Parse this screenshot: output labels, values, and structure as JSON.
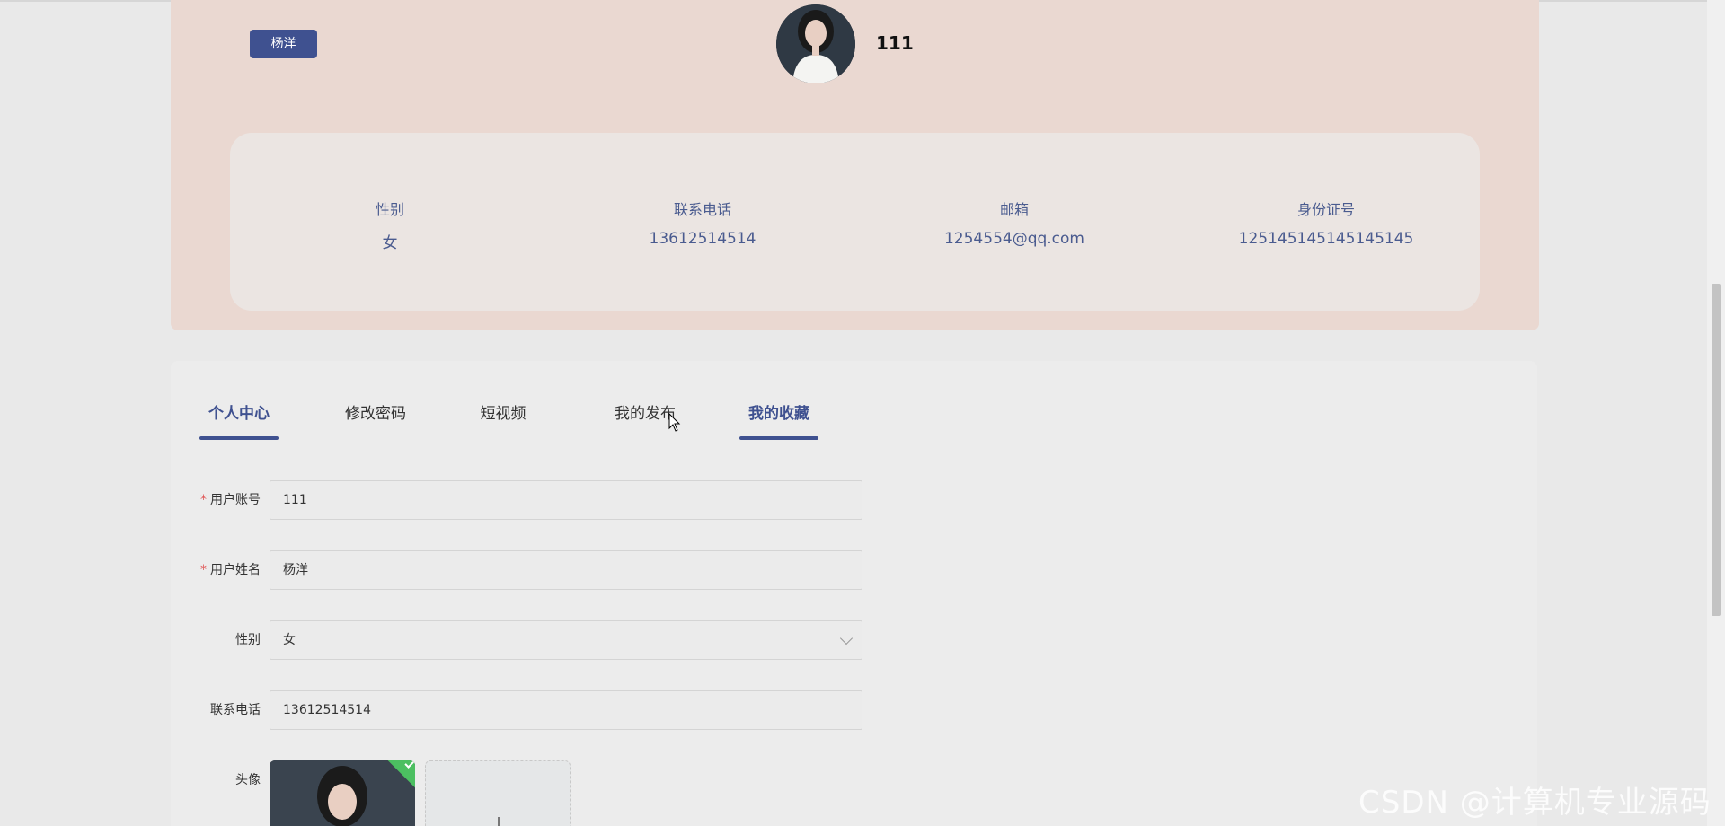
{
  "header": {
    "name_tag": "杨洋",
    "username": "111"
  },
  "info": {
    "items": [
      {
        "label": "性别",
        "value": "女"
      },
      {
        "label": "联系电话",
        "value": "13612514514"
      },
      {
        "label": "邮箱",
        "value": "1254554@qq.com"
      },
      {
        "label": "身份证号",
        "value": "125145145145145145"
      }
    ]
  },
  "tabs": [
    {
      "label": "个人中心",
      "active": true
    },
    {
      "label": "修改密码",
      "active": false
    },
    {
      "label": "短视频",
      "active": false
    },
    {
      "label": "我的发布",
      "active": false
    },
    {
      "label": "我的收藏",
      "active": true
    }
  ],
  "form": {
    "account": {
      "label": "用户账号",
      "required": "*",
      "value": "111"
    },
    "name": {
      "label": "用户姓名",
      "required": "*",
      "value": "杨洋"
    },
    "gender": {
      "label": "性别",
      "value": "女"
    },
    "phone": {
      "label": "联系电话",
      "value": "13612514514"
    },
    "avatar": {
      "label": "头像"
    }
  },
  "watermark": "CSDN @计算机专业源码",
  "colors": {
    "accent": "#3f5190",
    "banner": "#ead8d1",
    "success": "#4cbf61"
  }
}
